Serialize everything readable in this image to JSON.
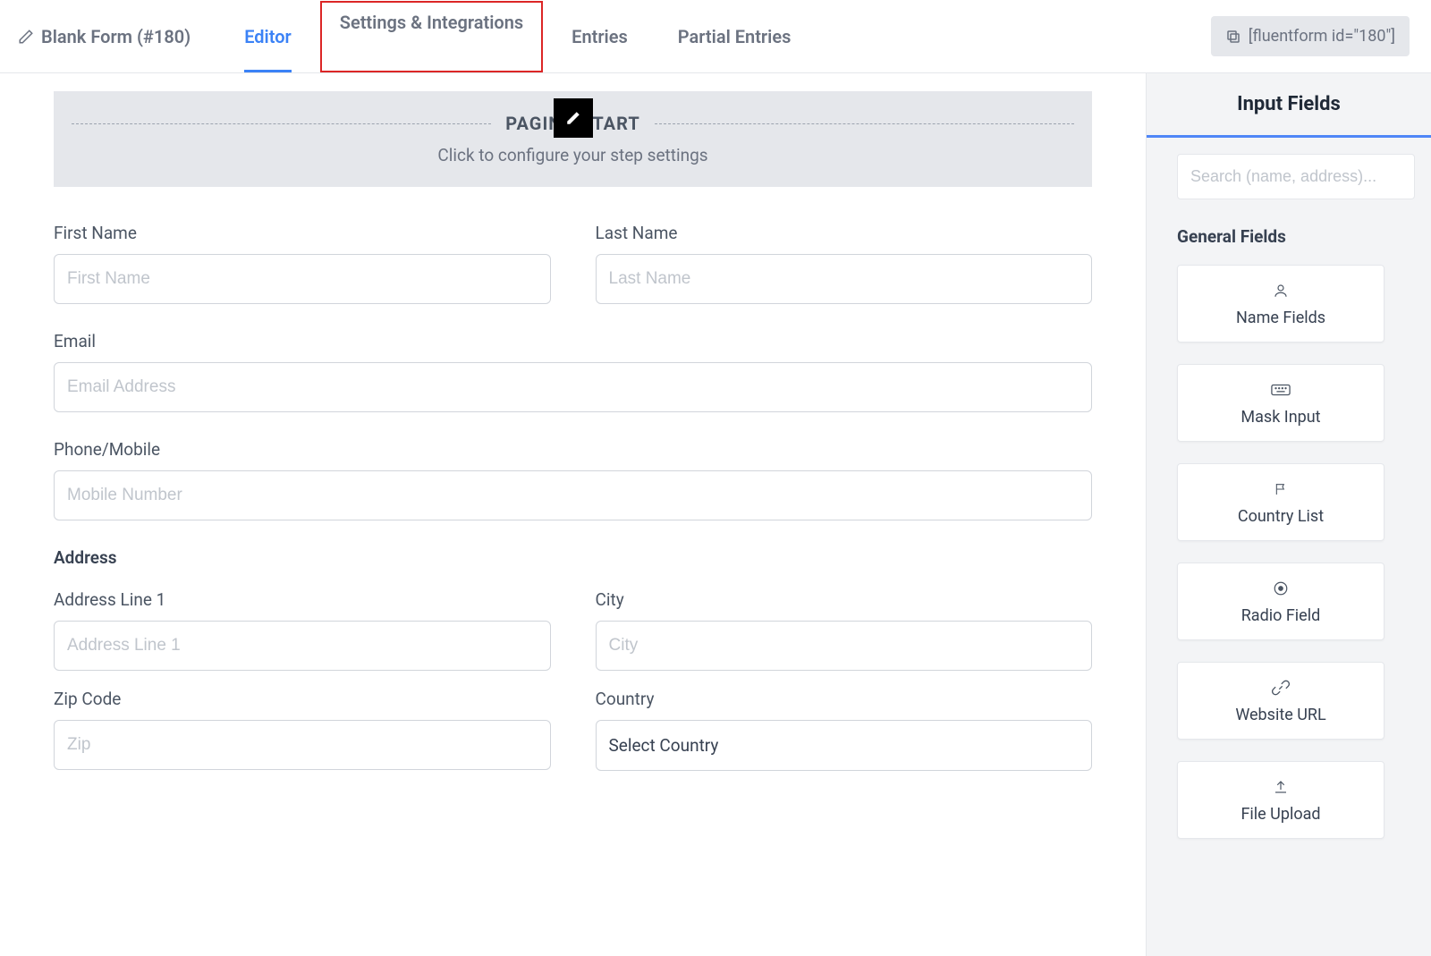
{
  "header": {
    "form_title": "Blank Form (#180)",
    "tabs": {
      "editor": "Editor",
      "settings": "Settings & Integrations",
      "entries": "Entries",
      "partial": "Partial Entries"
    },
    "shortcode": "[fluentform id=\"180\"]"
  },
  "paging": {
    "title": "PAGING START",
    "subtitle": "Click to configure your step settings"
  },
  "form": {
    "first_name": {
      "label": "First Name",
      "placeholder": "First Name"
    },
    "last_name": {
      "label": "Last Name",
      "placeholder": "Last Name"
    },
    "email": {
      "label": "Email",
      "placeholder": "Email Address"
    },
    "phone": {
      "label": "Phone/Mobile",
      "placeholder": "Mobile Number"
    },
    "address_section": "Address",
    "address1": {
      "label": "Address Line 1",
      "placeholder": "Address Line 1"
    },
    "city": {
      "label": "City",
      "placeholder": "City"
    },
    "zip": {
      "label": "Zip Code",
      "placeholder": "Zip"
    },
    "country": {
      "label": "Country",
      "value": "Select Country"
    }
  },
  "sidebar": {
    "title": "Input Fields",
    "search_placeholder": "Search (name, address)...",
    "section_title": "General Fields",
    "fields": {
      "name": "Name Fields",
      "mask": "Mask Input",
      "country": "Country List",
      "radio": "Radio Field",
      "url": "Website URL",
      "file": "File Upload"
    }
  }
}
